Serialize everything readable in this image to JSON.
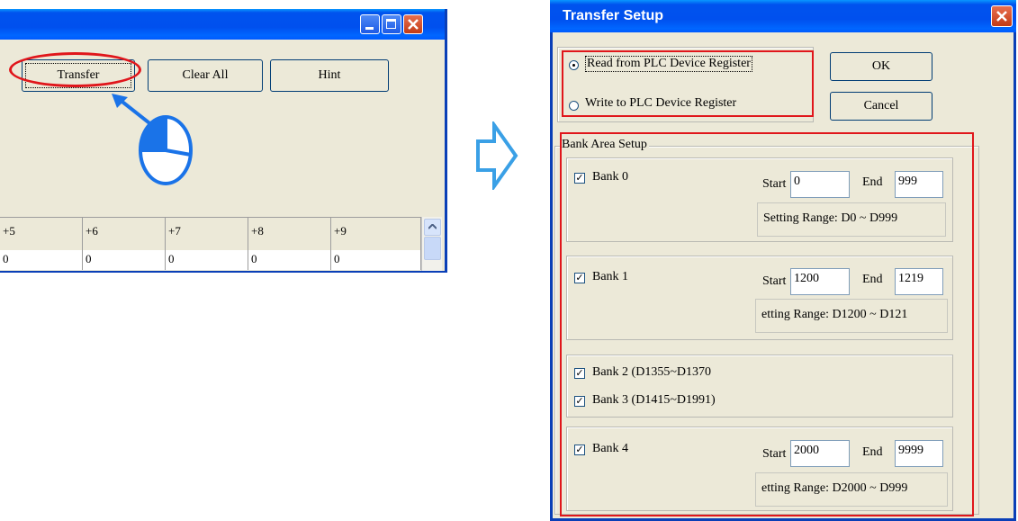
{
  "main_window": {
    "buttons": {
      "transfer": "Transfer",
      "clear_all": "Clear All",
      "hint": "Hint"
    },
    "grid": {
      "headers": [
        "+5",
        "+6",
        "+7",
        "+8",
        "+9"
      ],
      "row": [
        "0",
        "0",
        "0",
        "0",
        "0"
      ]
    }
  },
  "dialog": {
    "title": "Transfer Setup",
    "mode": {
      "read_label": "Read from PLC Device Register",
      "write_label": "Write to PLC Device Register",
      "selected": "read"
    },
    "ok_label": "OK",
    "cancel_label": "Cancel",
    "bank_area": {
      "title": "Bank Area Setup",
      "start_label": "Start",
      "end_label": "End",
      "banks": [
        {
          "label": "Bank 0",
          "checked": true,
          "start": "0",
          "end": "999",
          "range": "Setting Range: D0 ~ D999"
        },
        {
          "label": "Bank 1",
          "checked": true,
          "start": "1200",
          "end": "1219",
          "range": "etting Range: D1200 ~ D121"
        },
        {
          "label": "Bank 2 (D1355~D1370",
          "checked": true
        },
        {
          "label": "Bank 3 (D1415~D1991)",
          "checked": true
        },
        {
          "label": "Bank 4",
          "checked": true,
          "start": "2000",
          "end": "9999",
          "range": "etting Range: D2000 ~ D999"
        }
      ]
    }
  },
  "annotations": {
    "highlight_color": "#e0161b",
    "pointer_color": "#1a73e8"
  },
  "colors": {
    "titlebar": "#0050ee",
    "face": "#ece9d8"
  }
}
